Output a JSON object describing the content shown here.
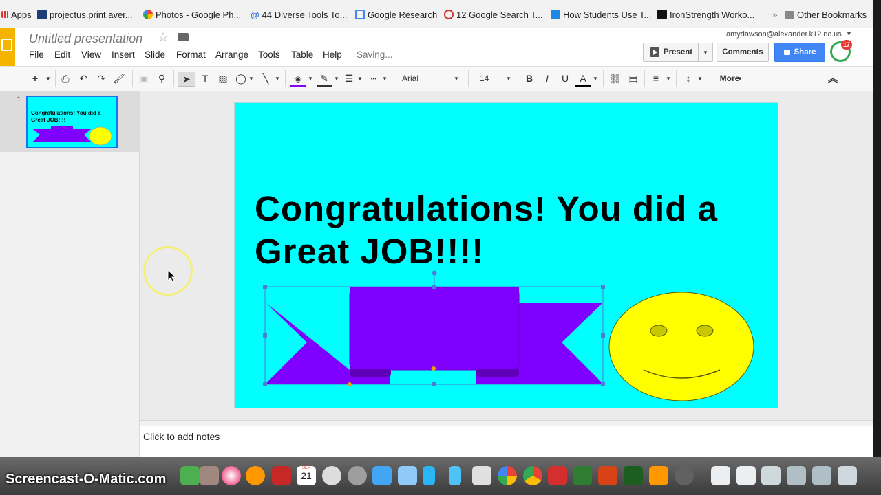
{
  "bookmarks": {
    "items": [
      {
        "label": "Apps"
      },
      {
        "label": "projectus.print.aver..."
      },
      {
        "label": "Photos - Google Ph..."
      },
      {
        "label": "44 Diverse Tools To..."
      },
      {
        "label": "Google Research"
      },
      {
        "label": "12 Google Search T..."
      },
      {
        "label": "How Students Use T..."
      },
      {
        "label": "IronStrength Worko..."
      }
    ],
    "overflow": "»",
    "other": "Other Bookmarks"
  },
  "header": {
    "title": "Untitled presentation",
    "menus": [
      "File",
      "Edit",
      "View",
      "Insert",
      "Slide",
      "Format",
      "Arrange",
      "Tools",
      "Table",
      "Help"
    ],
    "status": "Saving...",
    "account": "amydawson@alexander.k12.nc.us",
    "present_label": "Present",
    "comments_label": "Comments",
    "share_label": "Share",
    "notification_count": "17"
  },
  "toolbar": {
    "font": "Arial",
    "size": "14",
    "more": "More"
  },
  "filmstrip": {
    "slide_number": "1",
    "thumb_text": "Congratulations!  You did a Great JOB!!!!"
  },
  "slide": {
    "background": "#00ffff",
    "title": "Congratulations!  You did a Great JOB!!!!",
    "banner_color": "#8000ff",
    "smiley_color": "#ffff00"
  },
  "notes": {
    "placeholder": "Click to add notes"
  },
  "dock": {
    "watermark": "Screencast-O-Matic.com",
    "calendar_month": "SEP",
    "calendar_day": "21"
  }
}
